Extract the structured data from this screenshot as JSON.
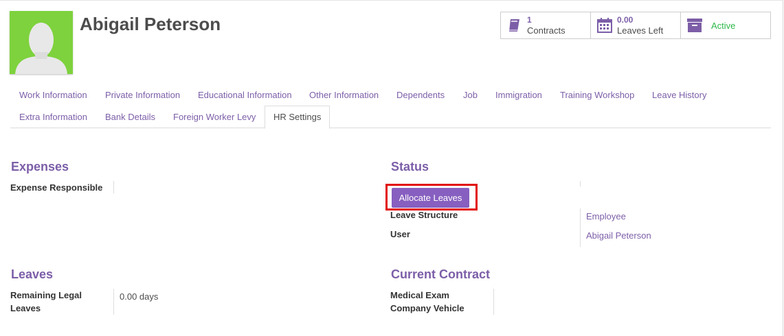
{
  "employee": {
    "name": "Abigail Peterson"
  },
  "stats": {
    "contracts_count": "1",
    "contracts_label": "Contracts",
    "leaves_count": "0.00",
    "leaves_label": "Leaves Left",
    "status_label": "Active"
  },
  "tabs": {
    "row1": [
      "Work Information",
      "Private Information",
      "Educational Information",
      "Other Information",
      "Dependents",
      "Job",
      "Immigration",
      "Training Workshop",
      "Leave History"
    ],
    "row2": [
      "Extra Information",
      "Bank Details",
      "Foreign Worker Levy",
      "HR Settings"
    ],
    "active": "HR Settings"
  },
  "expenses": {
    "title": "Expenses",
    "expense_responsible_label": "Expense Responsible"
  },
  "status": {
    "title": "Status",
    "allocate_button": "Allocate Leaves",
    "leave_structure_label": "Leave Structure",
    "leave_structure_value": "Employee",
    "user_label": "User",
    "user_value": "Abigail Peterson"
  },
  "leaves": {
    "title": "Leaves",
    "remaining_label_line1": "Remaining Legal",
    "remaining_label_line2": "Leaves",
    "remaining_value": "0.00 days"
  },
  "current_contract": {
    "title": "Current Contract",
    "medical_exam_label": "Medical Exam",
    "company_vehicle_label": "Company Vehicle"
  },
  "colors": {
    "accent": "#7c5ea8",
    "button": "#875fc0",
    "active": "#2eb84b",
    "highlight": "#e10b0b",
    "avatar_bg": "#7ed23d"
  }
}
